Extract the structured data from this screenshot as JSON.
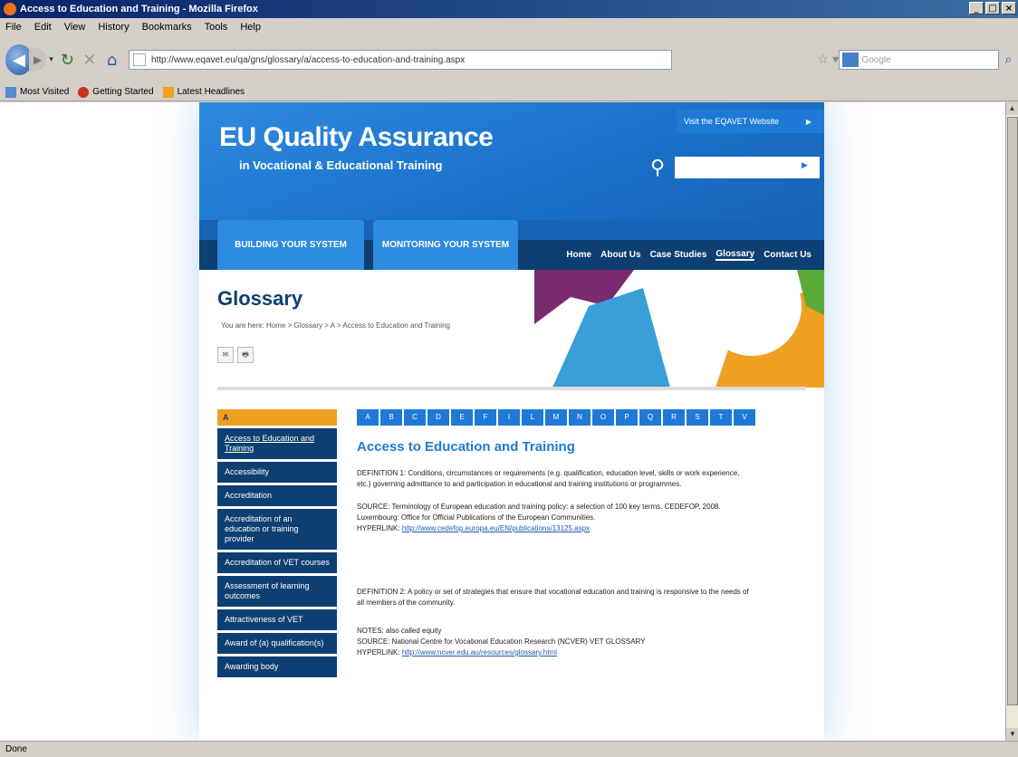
{
  "window": {
    "title": "Access to Education and Training - Mozilla Firefox",
    "controls": [
      "_",
      "□",
      "×"
    ]
  },
  "menu": [
    "File",
    "Edit",
    "View",
    "History",
    "Bookmarks",
    "Tools",
    "Help"
  ],
  "toolbar": {
    "url": "http://www.eqavet.eu/qa/gns/glossary/a/access-to-education-and-training.aspx",
    "search_placeholder": "Google"
  },
  "bookmarks": [
    "Most Visited",
    "Getting Started",
    "Latest Headlines"
  ],
  "status": "Done",
  "site": {
    "title": "EU Quality Assurance",
    "subtitle": "in Vocational & Educational Training",
    "vet_link": "Visit the EQAVET Website",
    "tabs": [
      "BUILDING YOUR SYSTEM",
      "MONITORING YOUR SYSTEM"
    ],
    "nav": [
      "Home",
      "About Us",
      "Case Studies",
      "Glossary",
      "Contact Us"
    ],
    "page_title": "Glossary",
    "breadcrumb": "You are here: Home > Glossary > A > Access to Education and Training",
    "tools": [
      "✉",
      "🖶"
    ]
  },
  "sidebar": {
    "heading": "A",
    "items": [
      "Access to Education and Training",
      "Accessibility",
      "Accreditation",
      "Accreditation of an education or training provider",
      "Accreditation of VET courses",
      "Assessment of learning outcomes",
      "Attractiveness of VET",
      "Award of (a) qualification(s)",
      "Awarding body"
    ]
  },
  "alphabet": [
    "A",
    "B",
    "C",
    "D",
    "E",
    "F",
    "I",
    "L",
    "M",
    "N",
    "O",
    "P",
    "Q",
    "R",
    "S",
    "T",
    "V"
  ],
  "entry": {
    "title": "Access to Education and Training",
    "def1": "DEFINITION 1: Conditions, circumstances or requirements (e.g. qualification, education level, skills or work experience, etc.) governing admittance to and participation in educational and training institutions or programmes.",
    "source1": "SOURCE: Terminology of European education and training policy: a selection of 100 key terms. CEDEFOP, 2008. Luxembourg: Office for Official Publications of the European Communities.",
    "hyperlink1_label": "HYPERLINK:",
    "hyperlink1": "http://www.cedefop.europa.eu/EN/publications/13125.aspx",
    "def2": "DEFINITION 2: A policy or set of strategies that ensure that vocational education and training is responsive to the needs of all members of the community.",
    "notes": "NOTES: also called equity",
    "source2": "SOURCE: National Centre for Vocational Education Research (NCVER) VET GLOSSARY",
    "hyperlink2_label": "HYPERLINK:",
    "hyperlink2": "http://www.ncver.edu.au/resources/glossary.html"
  }
}
